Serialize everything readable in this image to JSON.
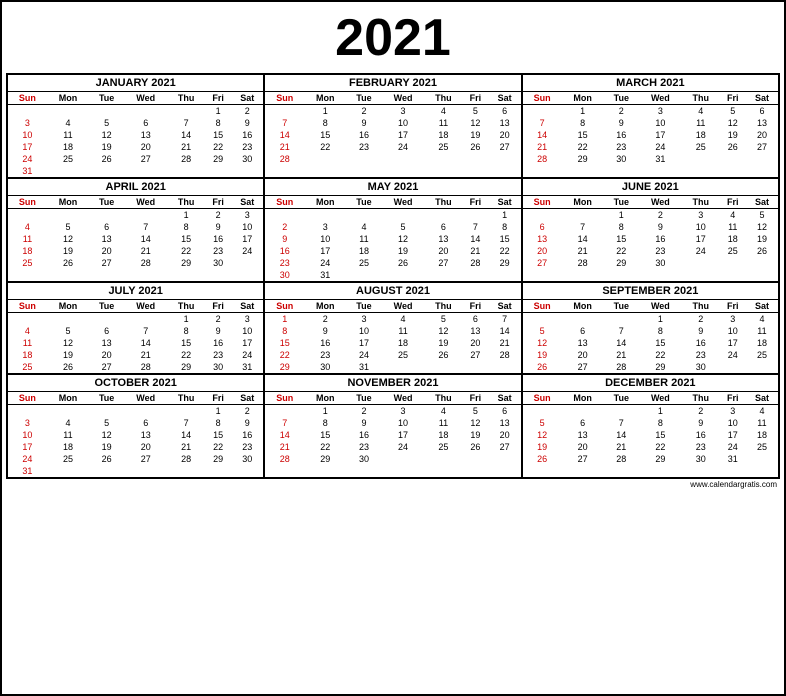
{
  "year": "2021",
  "footer": "www.calendargratis.com",
  "months": [
    {
      "name": "JANUARY 2021",
      "weeks": [
        [
          "",
          "",
          "",
          "",
          "",
          "1",
          "2"
        ],
        [
          "3",
          "4",
          "5",
          "6",
          "7",
          "8",
          "9"
        ],
        [
          "10",
          "11",
          "12",
          "13",
          "14",
          "15",
          "16"
        ],
        [
          "17",
          "18",
          "19",
          "20",
          "21",
          "22",
          "23"
        ],
        [
          "24",
          "25",
          "26",
          "27",
          "28",
          "29",
          "30"
        ],
        [
          "31",
          "",
          "",
          "",
          "",
          "",
          ""
        ]
      ]
    },
    {
      "name": "FEBRUARY 2021",
      "weeks": [
        [
          "",
          "1",
          "2",
          "3",
          "4",
          "5",
          "6"
        ],
        [
          "7",
          "8",
          "9",
          "10",
          "11",
          "12",
          "13"
        ],
        [
          "14",
          "15",
          "16",
          "17",
          "18",
          "19",
          "20"
        ],
        [
          "21",
          "22",
          "23",
          "24",
          "25",
          "26",
          "27"
        ],
        [
          "28",
          "",
          "",
          "",
          "",
          "",
          ""
        ],
        [
          "",
          "",
          "",
          "",
          "",
          "",
          ""
        ]
      ]
    },
    {
      "name": "MARCH 2021",
      "weeks": [
        [
          "",
          "1",
          "2",
          "3",
          "4",
          "5",
          "6"
        ],
        [
          "7",
          "8",
          "9",
          "10",
          "11",
          "12",
          "13"
        ],
        [
          "14",
          "15",
          "16",
          "17",
          "18",
          "19",
          "20"
        ],
        [
          "21",
          "22",
          "23",
          "24",
          "25",
          "26",
          "27"
        ],
        [
          "28",
          "29",
          "30",
          "31",
          "",
          "",
          ""
        ],
        [
          "",
          "",
          "",
          "",
          "",
          "",
          ""
        ]
      ]
    },
    {
      "name": "APRIL 2021",
      "weeks": [
        [
          "",
          "",
          "",
          "",
          "1",
          "2",
          "3"
        ],
        [
          "4",
          "5",
          "6",
          "7",
          "8",
          "9",
          "10"
        ],
        [
          "11",
          "12",
          "13",
          "14",
          "15",
          "16",
          "17"
        ],
        [
          "18",
          "19",
          "20",
          "21",
          "22",
          "23",
          "24"
        ],
        [
          "25",
          "26",
          "27",
          "28",
          "29",
          "30",
          ""
        ],
        [
          "",
          "",
          "",
          "",
          "",
          "",
          ""
        ]
      ]
    },
    {
      "name": "MAY 2021",
      "weeks": [
        [
          "",
          "",
          "",
          "",
          "",
          "",
          "1"
        ],
        [
          "2",
          "3",
          "4",
          "5",
          "6",
          "7",
          "8"
        ],
        [
          "9",
          "10",
          "11",
          "12",
          "13",
          "14",
          "15"
        ],
        [
          "16",
          "17",
          "18",
          "19",
          "20",
          "21",
          "22"
        ],
        [
          "23",
          "24",
          "25",
          "26",
          "27",
          "28",
          "29"
        ],
        [
          "30",
          "31",
          "",
          "",
          "",
          "",
          ""
        ]
      ]
    },
    {
      "name": "JUNE 2021",
      "weeks": [
        [
          "",
          "",
          "1",
          "2",
          "3",
          "4",
          "5"
        ],
        [
          "6",
          "7",
          "8",
          "9",
          "10",
          "11",
          "12"
        ],
        [
          "13",
          "14",
          "15",
          "16",
          "17",
          "18",
          "19"
        ],
        [
          "20",
          "21",
          "22",
          "23",
          "24",
          "25",
          "26"
        ],
        [
          "27",
          "28",
          "29",
          "30",
          "",
          "",
          ""
        ],
        [
          "",
          "",
          "",
          "",
          "",
          "",
          ""
        ]
      ]
    },
    {
      "name": "JULY 2021",
      "weeks": [
        [
          "",
          "",
          "",
          "",
          "1",
          "2",
          "3"
        ],
        [
          "4",
          "5",
          "6",
          "7",
          "8",
          "9",
          "10"
        ],
        [
          "11",
          "12",
          "13",
          "14",
          "15",
          "16",
          "17"
        ],
        [
          "18",
          "19",
          "20",
          "21",
          "22",
          "23",
          "24"
        ],
        [
          "25",
          "26",
          "27",
          "28",
          "29",
          "30",
          "31"
        ],
        [
          "",
          "",
          "",
          "",
          "",
          "",
          ""
        ]
      ]
    },
    {
      "name": "AUGUST 2021",
      "weeks": [
        [
          "1",
          "2",
          "3",
          "4",
          "5",
          "6",
          "7"
        ],
        [
          "8",
          "9",
          "10",
          "11",
          "12",
          "13",
          "14"
        ],
        [
          "15",
          "16",
          "17",
          "18",
          "19",
          "20",
          "21"
        ],
        [
          "22",
          "23",
          "24",
          "25",
          "26",
          "27",
          "28"
        ],
        [
          "29",
          "30",
          "31",
          "",
          "",
          "",
          ""
        ],
        [
          "",
          "",
          "",
          "",
          "",
          "",
          ""
        ]
      ]
    },
    {
      "name": "SEPTEMBER 2021",
      "weeks": [
        [
          "",
          "",
          "",
          "1",
          "2",
          "3",
          "4"
        ],
        [
          "5",
          "6",
          "7",
          "8",
          "9",
          "10",
          "11"
        ],
        [
          "12",
          "13",
          "14",
          "15",
          "16",
          "17",
          "18"
        ],
        [
          "19",
          "20",
          "21",
          "22",
          "23",
          "24",
          "25"
        ],
        [
          "26",
          "27",
          "28",
          "29",
          "30",
          "",
          ""
        ],
        [
          "",
          "",
          "",
          "",
          "",
          "",
          ""
        ]
      ]
    },
    {
      "name": "OCTOBER 2021",
      "weeks": [
        [
          "",
          "",
          "",
          "",
          "",
          "1",
          "2"
        ],
        [
          "3",
          "4",
          "5",
          "6",
          "7",
          "8",
          "9"
        ],
        [
          "10",
          "11",
          "12",
          "13",
          "14",
          "15",
          "16"
        ],
        [
          "17",
          "18",
          "19",
          "20",
          "21",
          "22",
          "23"
        ],
        [
          "24",
          "25",
          "26",
          "27",
          "28",
          "29",
          "30"
        ],
        [
          "31",
          "",
          "",
          "",
          "",
          "",
          ""
        ]
      ]
    },
    {
      "name": "NOVEMBER 2021",
      "weeks": [
        [
          "",
          "1",
          "2",
          "3",
          "4",
          "5",
          "6"
        ],
        [
          "7",
          "8",
          "9",
          "10",
          "11",
          "12",
          "13"
        ],
        [
          "14",
          "15",
          "16",
          "17",
          "18",
          "19",
          "20"
        ],
        [
          "21",
          "22",
          "23",
          "24",
          "25",
          "26",
          "27"
        ],
        [
          "28",
          "29",
          "30",
          "",
          "",
          "",
          ""
        ],
        [
          "",
          "",
          "",
          "",
          "",
          "",
          ""
        ]
      ]
    },
    {
      "name": "DECEMBER 2021",
      "weeks": [
        [
          "",
          "",
          "",
          "1",
          "2",
          "3",
          "4"
        ],
        [
          "5",
          "6",
          "7",
          "8",
          "9",
          "10",
          "11"
        ],
        [
          "12",
          "13",
          "14",
          "15",
          "16",
          "17",
          "18"
        ],
        [
          "19",
          "20",
          "21",
          "22",
          "23",
          "24",
          "25"
        ],
        [
          "26",
          "27",
          "28",
          "29",
          "30",
          "31",
          ""
        ],
        [
          "",
          "",
          "",
          "",
          "",
          "",
          ""
        ]
      ]
    }
  ],
  "days": [
    "Sun",
    "Mon",
    "Tue",
    "Wed",
    "Thu",
    "Fri",
    "Sat"
  ],
  "holidays": {
    "JANUARY 2021": {
      "1_5": true
    },
    "FEBRUARY 2021": {
      "1_4": true
    },
    "MARCH 2021": {
      "1_4": true
    },
    "APRIL 2021": {},
    "MAY 2021": {},
    "JUNE 2021": {},
    "JULY 2021": {},
    "AUGUST 2021": {},
    "SEPTEMBER 2021": {},
    "OCTOBER 2021": {},
    "NOVEMBER 2021": {
      "1_4": true,
      "2_4": true
    },
    "DECEMBER 2021": {
      "1_3": true
    }
  }
}
